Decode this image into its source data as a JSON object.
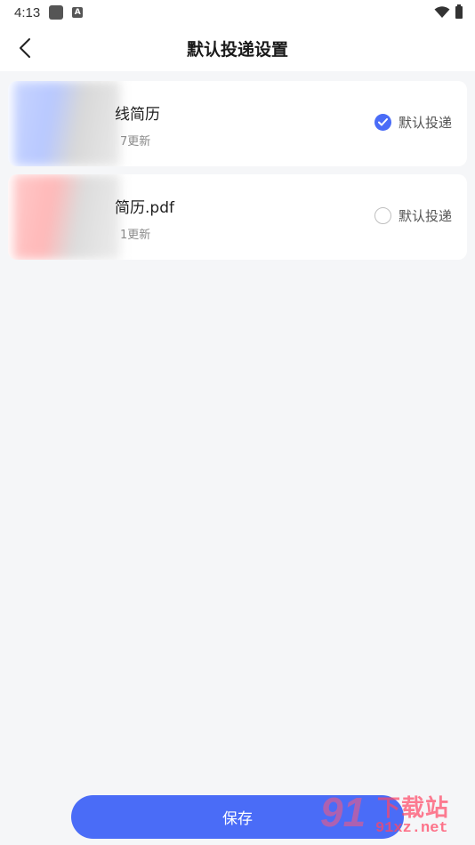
{
  "status_bar": {
    "time": "4:13",
    "notification_icon": "A"
  },
  "header": {
    "title": "默认投递设置"
  },
  "resumes": [
    {
      "name": "线简历",
      "updated": "7更新",
      "option_label": "默认投递",
      "selected": true,
      "thumb_color": "#c7d4ff"
    },
    {
      "name": "简历.pdf",
      "updated": "1更新",
      "option_label": "默认投递",
      "selected": false,
      "thumb_color": "#ffc9c9"
    }
  ],
  "footer": {
    "save_label": "保存"
  },
  "watermark": {
    "logo_number": "91",
    "site_cn": "下载站",
    "site_url": "91xz.net"
  },
  "colors": {
    "accent": "#4a6cf7",
    "background": "#f5f6f8"
  }
}
